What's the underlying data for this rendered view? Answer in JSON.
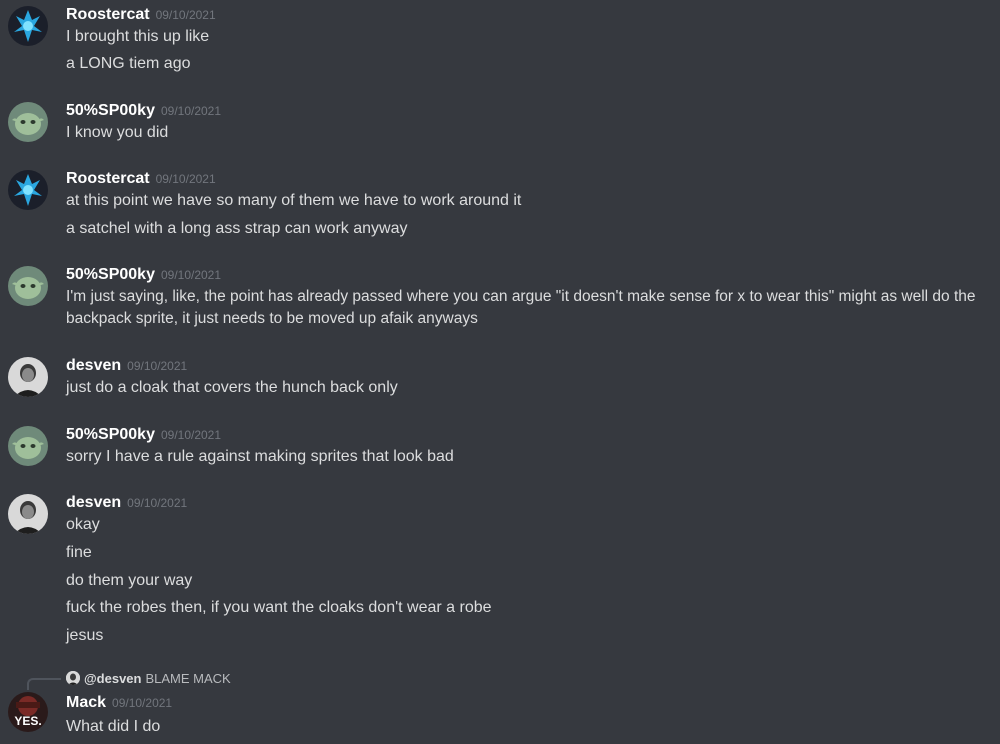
{
  "messages": [
    {
      "author": "Roostercat",
      "timestamp": "09/10/2021",
      "lines": [
        "I brought this up like",
        "a LONG tiem ago"
      ]
    },
    {
      "author": "50%SP00ky",
      "timestamp": "09/10/2021",
      "lines": [
        "I know you did"
      ]
    },
    {
      "author": "Roostercat",
      "timestamp": "09/10/2021",
      "lines": [
        "at this point we have so many of them we have to work around it",
        "a satchel with a long ass strap can work anyway"
      ]
    },
    {
      "author": "50%SP00ky",
      "timestamp": "09/10/2021",
      "lines": [
        "I'm just saying, like, the point has already passed where you can argue \"it doesn't make sense for x to wear this\" might as well do the backpack sprite, it just needs to be moved up afaik anyways"
      ]
    },
    {
      "author": "desven",
      "timestamp": "09/10/2021",
      "lines": [
        "just do a cloak that covers the hunch back only"
      ]
    },
    {
      "author": "50%SP00ky",
      "timestamp": "09/10/2021",
      "lines": [
        "sorry I have a rule against making sprites that look bad"
      ]
    },
    {
      "author": "desven",
      "timestamp": "09/10/2021",
      "lines": [
        "okay",
        "fine",
        "do them your way",
        "fuck the robes then, if you want the cloaks don't wear a robe",
        "jesus"
      ]
    },
    {
      "author": "Mack",
      "timestamp": "09/10/2021",
      "reply": {
        "author": "@desven",
        "text": "BLAME MACK"
      },
      "avatar_text": "YES.",
      "lines": [
        "What did I do"
      ]
    }
  ],
  "colors": {
    "background": "#36393f",
    "username": "#ffffff",
    "text": "#dcddde",
    "timestamp": "#72767d"
  }
}
